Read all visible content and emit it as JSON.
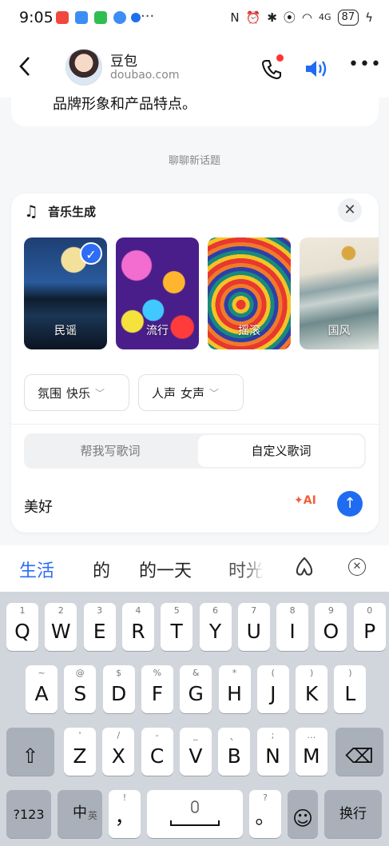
{
  "status_bar": {
    "time": "9:05",
    "battery": "87",
    "network": "4G"
  },
  "header": {
    "back_icon": "back-arrow",
    "name": "豆包",
    "domain": "doubao.com"
  },
  "chat": {
    "prev_message_tail": "品牌形象和产品特点。",
    "new_topic": "聊聊新话题"
  },
  "music_card": {
    "title": "音乐生成",
    "styles": [
      {
        "label": "民谣",
        "selected": true
      },
      {
        "label": "流行",
        "selected": false
      },
      {
        "label": "摇滚",
        "selected": false
      },
      {
        "label": "国风",
        "selected": false
      }
    ],
    "mood": {
      "label": "氛围",
      "value": "快乐"
    },
    "voice": {
      "label": "人声",
      "value": "女声"
    },
    "tabs": [
      "帮我写歌词",
      "自定义歌词"
    ],
    "active_tab": "自定义歌词",
    "input_value": "美好",
    "ai_label": "AI"
  },
  "candidates": [
    "生活",
    "的",
    "的一天",
    "时光"
  ],
  "keyboard": {
    "row1": [
      {
        "k": "Q",
        "s": "1"
      },
      {
        "k": "W",
        "s": "2"
      },
      {
        "k": "E",
        "s": "3"
      },
      {
        "k": "R",
        "s": "4"
      },
      {
        "k": "T",
        "s": "5"
      },
      {
        "k": "Y",
        "s": "6"
      },
      {
        "k": "U",
        "s": "7"
      },
      {
        "k": "I",
        "s": "8"
      },
      {
        "k": "O",
        "s": "9"
      },
      {
        "k": "P",
        "s": "0"
      }
    ],
    "row2": [
      {
        "k": "A",
        "s": "~"
      },
      {
        "k": "S",
        "s": "@"
      },
      {
        "k": "D",
        "s": "$"
      },
      {
        "k": "F",
        "s": "%"
      },
      {
        "k": "G",
        "s": "&"
      },
      {
        "k": "H",
        "s": "*"
      },
      {
        "k": "J",
        "s": "("
      },
      {
        "k": "K",
        "s": ")"
      },
      {
        "k": "L",
        "s": ")"
      }
    ],
    "row3": [
      {
        "k": "Z",
        "s": "'"
      },
      {
        "k": "X",
        "s": "/"
      },
      {
        "k": "C",
        "s": "-"
      },
      {
        "k": "V",
        "s": "_"
      },
      {
        "k": "B",
        "s": "、"
      },
      {
        "k": "N",
        "s": ";"
      },
      {
        "k": "M",
        "s": "…"
      }
    ],
    "num_key": "?123",
    "lang_key": "中",
    "lang_sub": "英",
    "comma_key": "，",
    "comma_sub": "!",
    "period_key": "。",
    "period_sub": "?",
    "enter_key": "换行"
  }
}
